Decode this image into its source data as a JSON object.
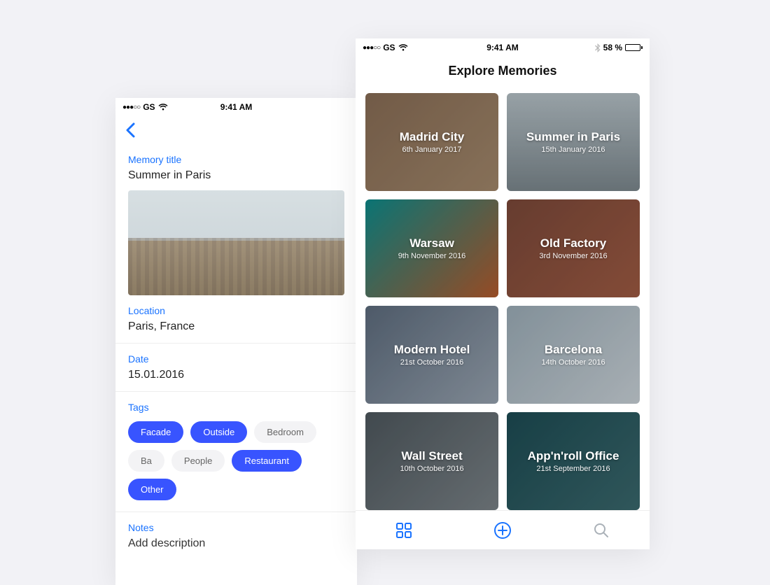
{
  "status": {
    "carrier": "GS",
    "time": "9:41 AM",
    "battery_pct": "58 %",
    "battery_fill_pct": 58
  },
  "edit_screen": {
    "field_labels": {
      "title": "Memory title",
      "location": "Location",
      "date": "Date",
      "tags": "Tags",
      "notes": "Notes"
    },
    "title_value": "Summer in Paris",
    "location_value": "Paris, France",
    "date_value": "15.01.2016",
    "notes_placeholder": "Add description",
    "tags": [
      {
        "label": "Facade",
        "selected": true
      },
      {
        "label": "Outside",
        "selected": true
      },
      {
        "label": "Bedroom",
        "selected": false
      },
      {
        "label": "Ba",
        "selected": false
      },
      {
        "label": "People",
        "selected": false
      },
      {
        "label": "Restaurant",
        "selected": true
      },
      {
        "label": "Other",
        "selected": true
      }
    ]
  },
  "explore_screen": {
    "title": "Explore Memories",
    "cards": [
      {
        "title": "Madrid City",
        "date": "6th January 2017",
        "bg": "linear-gradient(135deg,#8b6f57,#a58a6d)"
      },
      {
        "title": "Summer in Paris",
        "date": "15th January 2016",
        "bg": "linear-gradient(180deg,#b9c5cb,#7e8a90)"
      },
      {
        "title": "Warsaw",
        "date": "9th November 2016",
        "bg": "linear-gradient(135deg,#0d8e8e,#b85c2d)"
      },
      {
        "title": "Old Factory",
        "date": "3rd November 2016",
        "bg": "linear-gradient(135deg,#7d4a3a,#a15c44)"
      },
      {
        "title": "Modern Hotel",
        "date": "21st October 2016",
        "bg": "linear-gradient(135deg,#5f6e80,#9aa6b3)"
      },
      {
        "title": "Barcelona",
        "date": "14th October 2016",
        "bg": "linear-gradient(135deg,#9fb0bb,#cdd6dc)"
      },
      {
        "title": "Wall Street",
        "date": "10th October 2016",
        "bg": "linear-gradient(135deg,#505a60,#7c8489)"
      },
      {
        "title": "App'n'roll Office",
        "date": "21st September 2016",
        "bg": "linear-gradient(135deg,#1d4d55,#3b6a6f)"
      }
    ]
  }
}
